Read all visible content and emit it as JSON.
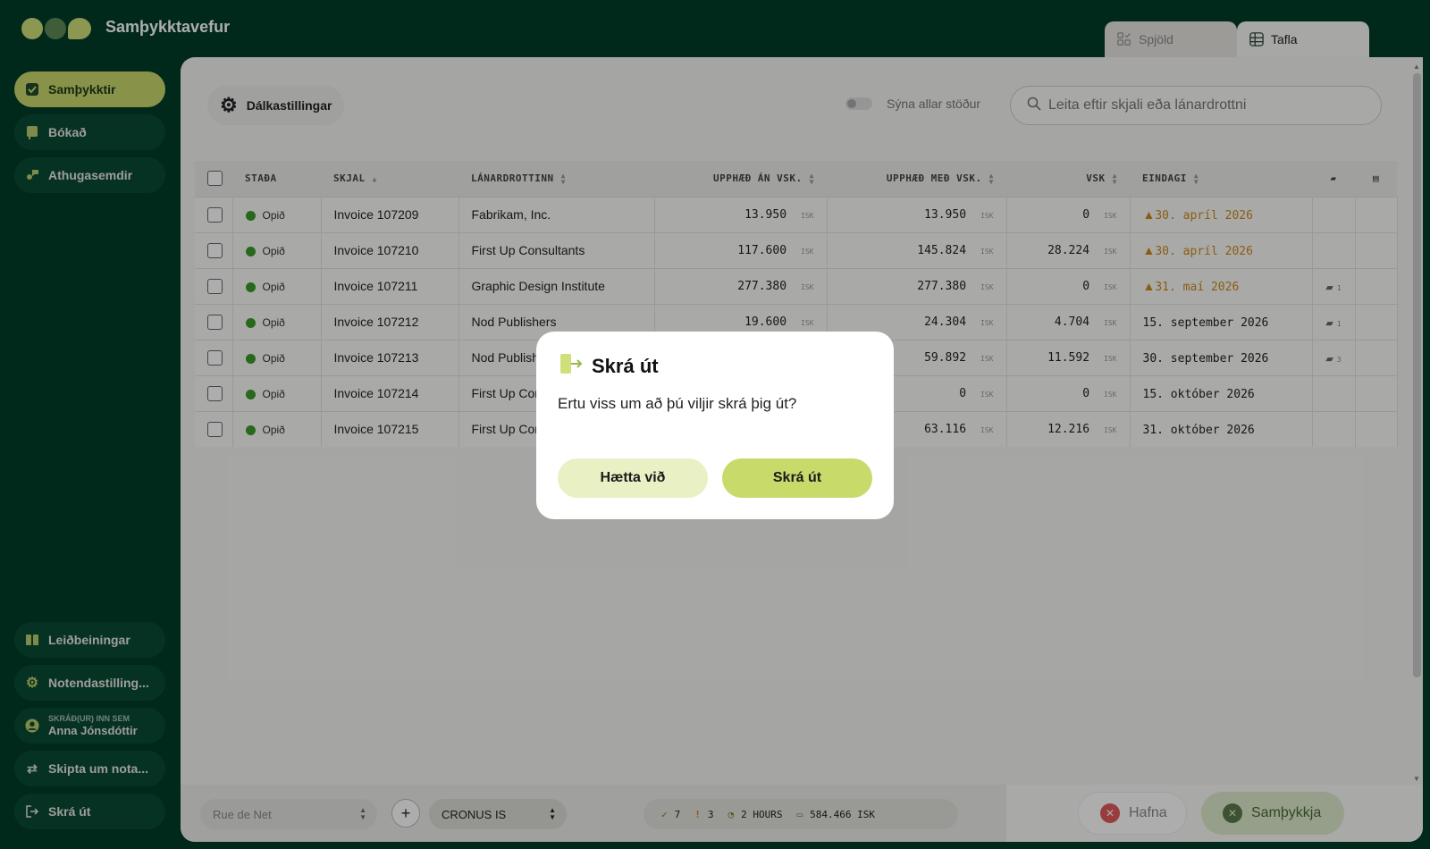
{
  "app": {
    "title": "Samþykktavefur"
  },
  "view_tabs": [
    {
      "label": "Spjöld",
      "icon": "cards-check-icon"
    },
    {
      "label": "Tafla",
      "icon": "table-icon"
    }
  ],
  "sidebar": {
    "items": [
      {
        "label": "Samþykktir",
        "icon": "approvals-icon",
        "active": true
      },
      {
        "label": "Bókað",
        "icon": "booked-icon"
      },
      {
        "label": "Athugasemdir",
        "icon": "comments-user-icon"
      }
    ],
    "bottom": [
      {
        "label": "Leiðbeiningar",
        "icon": "book-icon"
      },
      {
        "label": "Notendastilling...",
        "icon": "gear-icon"
      }
    ],
    "user": {
      "caption": "SKRÁÐ(UR) INN SEM",
      "name": "Anna Jónsdóttir"
    },
    "switch_user": "Skipta um nota...",
    "logout": "Skrá út"
  },
  "toolbar": {
    "column_settings": "Dálkastillingar",
    "show_all_statuses": "Sýna allar stöður",
    "show_all_on": false,
    "search_placeholder": "Leita eftir skjali eða lánardrottni"
  },
  "table": {
    "columns": [
      "STAÐA",
      "SKJAL",
      "LÁNARDROTTINN",
      "UPPHÆÐ ÁN VSK.",
      "UPPHÆÐ MEÐ VSK.",
      "VSK",
      "EINDAGI"
    ],
    "currency": "ISK",
    "rows": [
      {
        "status": "Opið",
        "doc": "Invoice 107209",
        "vendor": "Fabrikam, Inc.",
        "net": "13.950",
        "gross": "13.950",
        "vat": "0",
        "due": "30. apríl 2026",
        "overdue": true,
        "comments": ""
      },
      {
        "status": "Opið",
        "doc": "Invoice 107210",
        "vendor": "First Up Consultants",
        "net": "117.600",
        "gross": "145.824",
        "vat": "28.224",
        "due": "30. apríl 2026",
        "overdue": true,
        "comments": ""
      },
      {
        "status": "Opið",
        "doc": "Invoice 107211",
        "vendor": "Graphic Design Institute",
        "net": "277.380",
        "gross": "277.380",
        "vat": "0",
        "due": "31. maí 2026",
        "overdue": true,
        "comments": "1"
      },
      {
        "status": "Opið",
        "doc": "Invoice 107212",
        "vendor": "Nod Publishers",
        "net": "19.600",
        "gross": "24.304",
        "vat": "4.704",
        "due": "15. september 2026",
        "overdue": false,
        "comments": "1"
      },
      {
        "status": "Opið",
        "doc": "Invoice 107213",
        "vendor": "Nod Publish",
        "net": "",
        "gross": "59.892",
        "vat": "11.592",
        "due": "30. september 2026",
        "overdue": false,
        "comments": "3"
      },
      {
        "status": "Opið",
        "doc": "Invoice 107214",
        "vendor": "First Up Cor",
        "net": "",
        "gross": "0",
        "vat": "0",
        "due": "15. október 2026",
        "overdue": false,
        "comments": ""
      },
      {
        "status": "Opið",
        "doc": "Invoice 107215",
        "vendor": "First Up Cor",
        "net": "",
        "gross": "63.116",
        "vat": "12.216",
        "due": "31. október 2026",
        "overdue": false,
        "comments": ""
      }
    ]
  },
  "bottombar": {
    "select1": "Rue de Net",
    "select2": "CRONUS IS",
    "stats": {
      "approvals": "7",
      "warnings": "3",
      "time": "2 HOURS",
      "total": "584.466 ISK"
    },
    "reject": "Hafna",
    "approve": "Samþykkja"
  },
  "modal": {
    "title": "Skrá út",
    "message": "Ertu viss um að þú viljir skrá þig út?",
    "cancel": "Hætta við",
    "confirm": "Skrá út"
  },
  "colors": {
    "dark_green": "#003d2a",
    "accent": "#c8da6a",
    "warning": "#cc8a1a",
    "status_open": "#3a9a2a"
  }
}
